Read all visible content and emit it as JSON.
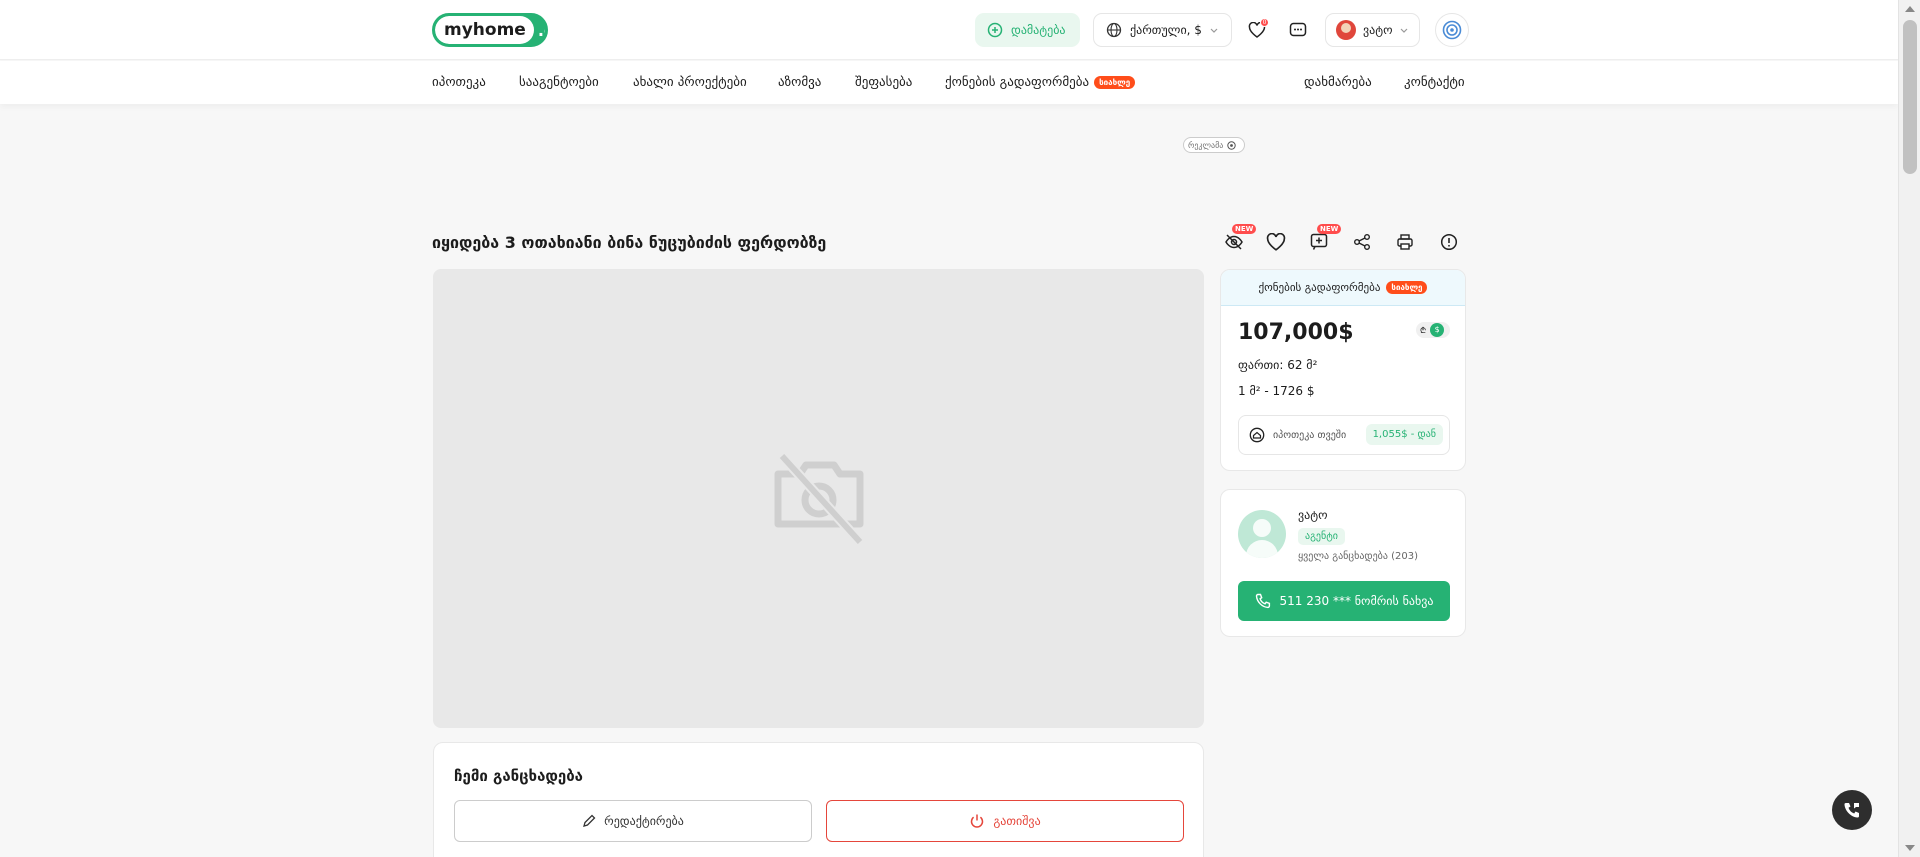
{
  "header": {
    "logo_main": "myhome",
    "logo_suffix": ".ge",
    "add_label": "დამატება",
    "language_currency": "ქართული, $",
    "favorites_count": "0",
    "user_name": "ვატო"
  },
  "nav": {
    "items": [
      "იპოთეკა",
      "სააგენტოები",
      "ახალი პროექტები",
      "აზომვა",
      "შეფასება",
      "ქონების გადაფორმება"
    ],
    "new_badge": "სიახლე",
    "right_items": [
      "დახმარება",
      "კონტაქტი"
    ]
  },
  "ad": {
    "label": "რეკლამა"
  },
  "listing": {
    "title": "იყიდება 3 ოთახიანი ბინა ნუცუბიძის ფერდობზე",
    "new_tag": "NEW"
  },
  "price_card": {
    "header": "ქონების გადაფორმება",
    "header_badge": "სიახლე",
    "price": "107,000$",
    "currency_gel": "₾",
    "currency_usd": "$",
    "area": "ფართი: 62 მ²",
    "price_per_m2": "1 მ² - 1726 $",
    "mortgage_label": "იპოთეკა თვეში",
    "mortgage_value": "1,055$ - დან"
  },
  "agent": {
    "name": "ვატო",
    "role": "აგენტი",
    "all_listings": "ყველა განცხადება (203)",
    "phone_label": "511 230 ***  ნომრის ნახვა"
  },
  "my_listing": {
    "title": "ჩემი განცხადება",
    "edit_label": "რედაქტირება",
    "deactivate_label": "გათიშვა"
  },
  "colors": {
    "brand_green": "#26b274",
    "danger_red": "#e5463b",
    "new_orange": "#ff4d1a"
  }
}
